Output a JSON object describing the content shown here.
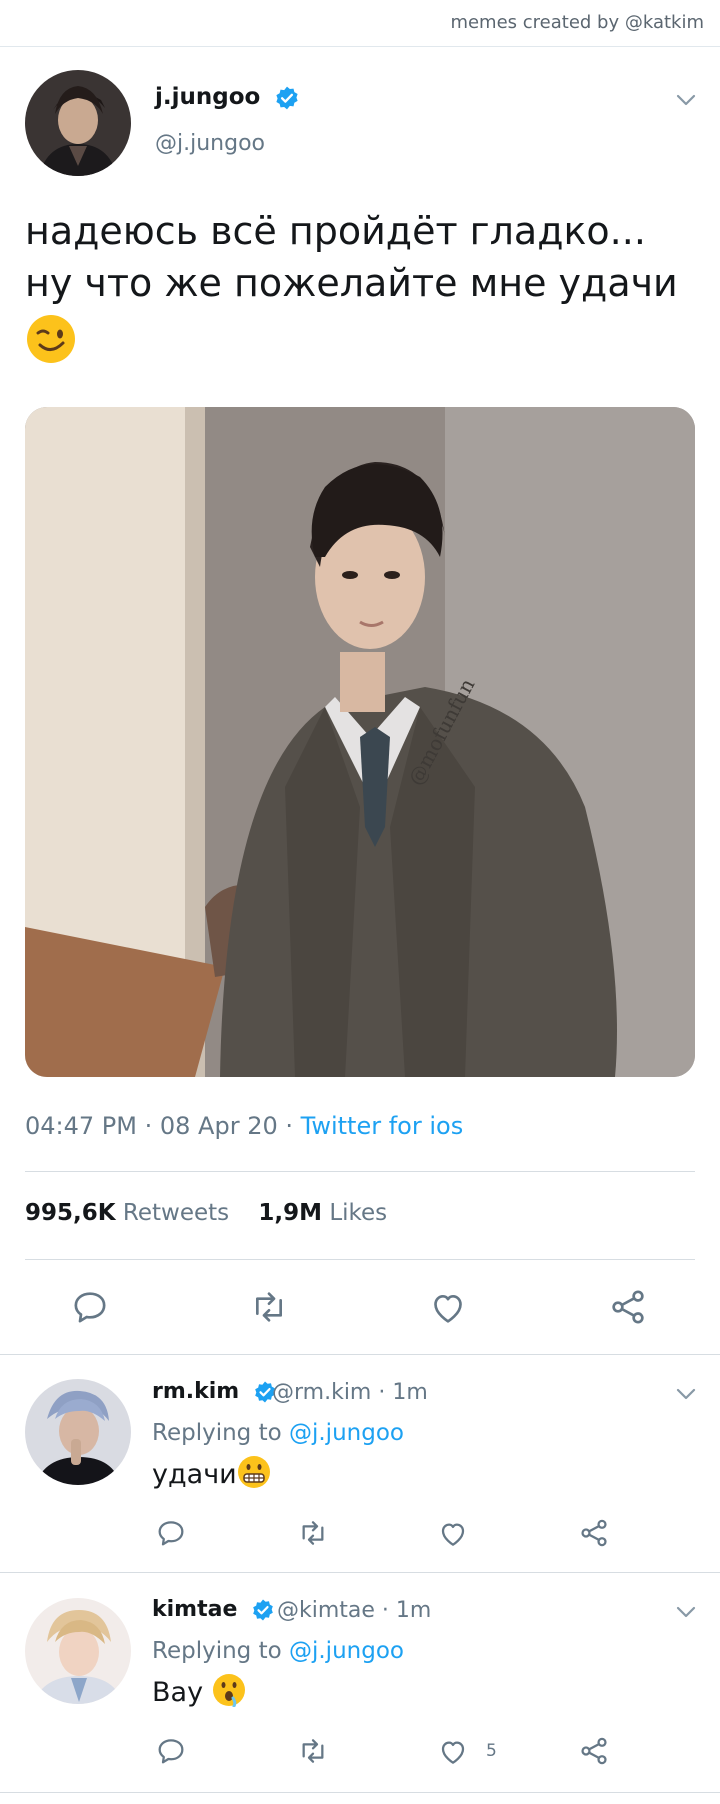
{
  "credit": "memes created by @katkim",
  "tweet": {
    "author_name": "j.jungoo",
    "author_handle": "@j.jungoo",
    "text_line1": "надеюсь всё пройдёт гладко...",
    "text_line2": "ну что же пожелайте мне удачи",
    "emoji": "winking-face",
    "photo_watermark": "@mofunfun",
    "time": "04:47 PM",
    "date": "08 Apr 20",
    "source": "Twitter for ios",
    "retweets_count": "995,6K",
    "retweets_label": "Retweets",
    "likes_count": "1,9M",
    "likes_label": "Likes"
  },
  "replies": [
    {
      "name": "rm.kim",
      "handle": "@rm.kim",
      "time": "1m",
      "replying_prefix": "Replying to",
      "replying_to": "@j.jungoo",
      "text": "удачи",
      "emoji": "grimacing-face",
      "like_count": ""
    },
    {
      "name": "kimtae",
      "handle": "@kimtae",
      "time": "1m",
      "replying_prefix": "Replying to",
      "replying_to": "@j.jungoo",
      "text": "Вау",
      "emoji": "astonished-drooling-face",
      "like_count": "5"
    }
  ],
  "icons": [
    "verified-badge",
    "chevron-down-icon",
    "reply-icon",
    "retweet-icon",
    "like-icon",
    "share-icon"
  ],
  "colors": {
    "accent": "#1da1f2",
    "muted": "#657786",
    "text": "#14171a",
    "divider": "#e1e8ed"
  }
}
